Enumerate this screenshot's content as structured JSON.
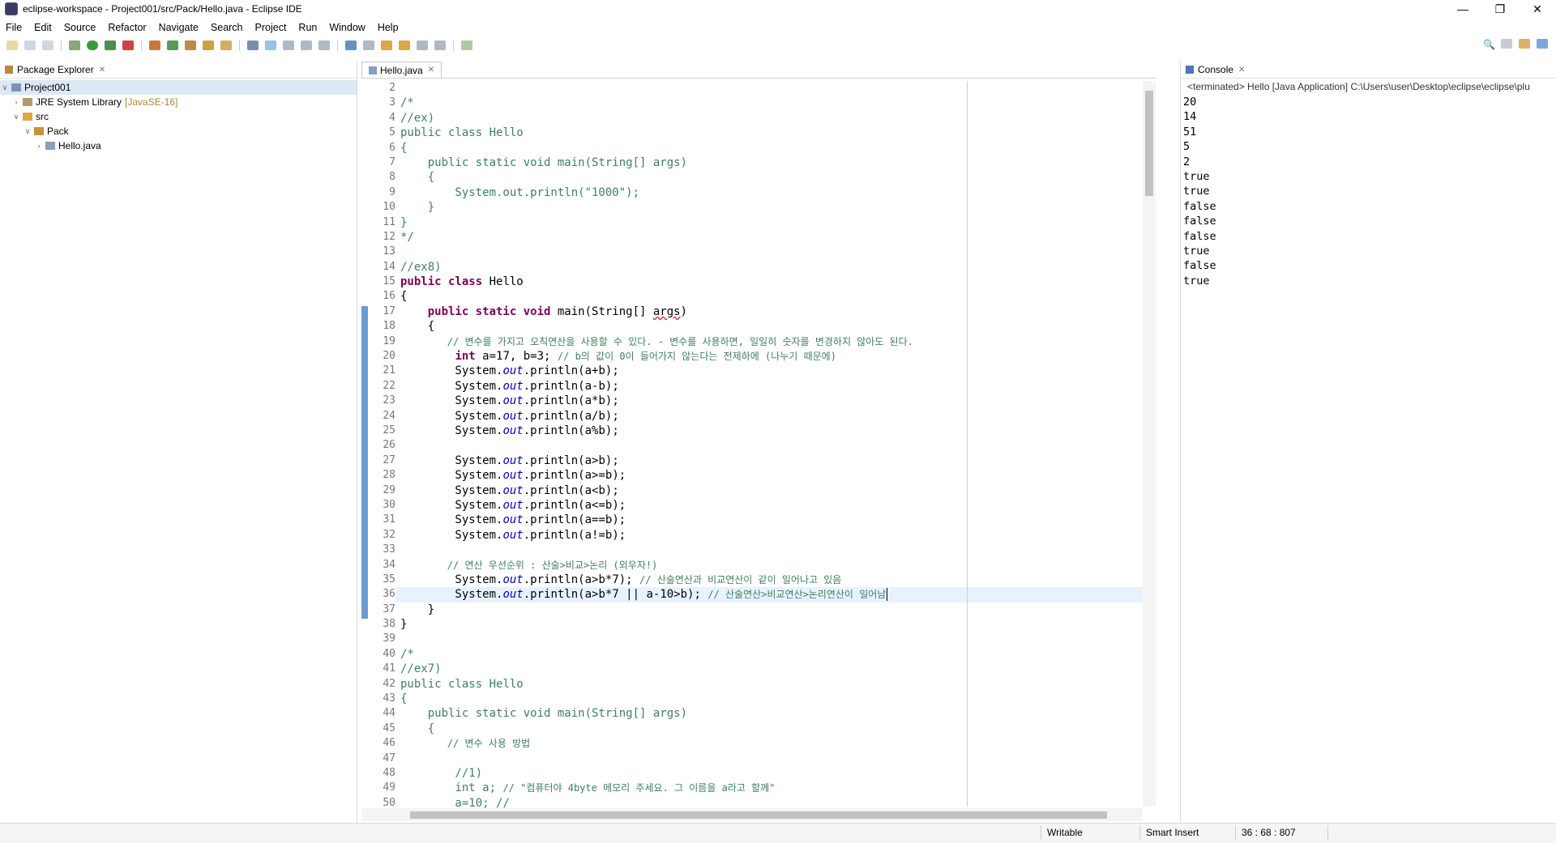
{
  "window": {
    "title": "eclipse-workspace - Project001/src/Pack/Hello.java - Eclipse IDE"
  },
  "menu": [
    "File",
    "Edit",
    "Source",
    "Refactor",
    "Navigate",
    "Search",
    "Project",
    "Run",
    "Window",
    "Help"
  ],
  "package_explorer": {
    "tab_label": "Package Explorer",
    "project": "Project001",
    "jre": "JRE System Library",
    "jre_decor": "[JavaSE-16]",
    "src": "src",
    "package": "Pack",
    "file": "Hello.java"
  },
  "editor": {
    "tab_label": "Hello.java",
    "line_numbers": [
      "2",
      "3",
      "4",
      "5",
      "6",
      "7",
      "8",
      "9",
      "10",
      "11",
      "12",
      "13",
      "14",
      "15",
      "16",
      "17",
      "18",
      "19",
      "20",
      "21",
      "22",
      "23",
      "24",
      "25",
      "26",
      "27",
      "28",
      "29",
      "30",
      "31",
      "32",
      "33",
      "34",
      "35",
      "36",
      "37",
      "38",
      "39",
      "40",
      "41",
      "42",
      "43",
      "44",
      "45",
      "46",
      "47",
      "48",
      "49",
      "50"
    ],
    "code": {
      "l3": "/*",
      "l4": "//ex)",
      "l5a": "public class",
      "l5b": " Hello",
      "l6": "{",
      "l7a": "    ",
      "l7b": "public static void",
      "l7c": " main(String[] ",
      "l7d": "args",
      "l7e": ")",
      "l8": "    {",
      "l9a": "        System.out.println(",
      "l9b": "\"1000\"",
      "l9c": ");",
      "l10": "    }",
      "l11": "}",
      "l12": "*/",
      "l14": "//ex8)",
      "l15a": "public class",
      "l15b": " Hello",
      "l16": "{",
      "l17a": "    ",
      "l17b": "public static void",
      "l17c": " main(String[] ",
      "l17d": "args",
      "l17e": ")",
      "l18": "    {",
      "l19": "        // 변수를 가지고 오칙연산을 사용할 수 있다. - 변수를 사용하면, 일일히 숫자를 변경하지 않아도 된다.",
      "l20a": "        ",
      "l20b": "int",
      "l20c": " a=17, b=3; ",
      "l20d": "// b의 값이 0이 들어가지 않는다는 전제하에 (나누기 때문에)",
      "l21": "(a+b);",
      "l22": "(a-b);",
      "l23": "(a*b);",
      "l24": "(a/b);",
      "l25": "(a%b);",
      "l27": "(a>b);",
      "l28": "(a>=b);",
      "l29": "(a<b);",
      "l30": "(a<=b);",
      "l31": "(a==b);",
      "l32": "(a!=b);",
      "l34": "        // 연산 우선순위 : 산술>비교>논리 (외우자!)",
      "l35a": "(a>b*7); ",
      "l35b": "// 산술연산과 비교연산이 같이 일어나고 있음",
      "l36a": "(a>b*7 || a-10>b); ",
      "l36b": "// 산술연산>비교연산>논리연산이 일어남",
      "l37": "    }",
      "l38": "}",
      "l40": "/*",
      "l41": "//ex7)",
      "l42a": "public class",
      "l42b": " Hello",
      "l43": "{",
      "l44a": "    ",
      "l44b": "public static void",
      "l44c": " main(String[] ",
      "l44d": "args",
      "l44e": ")",
      "l45": "    {",
      "l46": "        // 변수 사용 방법",
      "l48": "        //1)",
      "l49a": "        ",
      "l49b": "int",
      "l49c": " a; ",
      "l49d": "// \"컴퓨터야 4byte 메모리 주세요. 그 이름을 a라고 할께\"",
      "l50a": "        a=10; ",
      "l50b": "//"
    },
    "sysout_prefix": "        System.",
    "out_field": "out",
    "println": ".println"
  },
  "console": {
    "tab_label": "Console",
    "header": "<terminated> Hello [Java Application] C:\\Users\\user\\Desktop\\eclipse\\eclipse\\plu",
    "output": [
      "20",
      "14",
      "51",
      "5",
      "2",
      "true",
      "true",
      "false",
      "false",
      "false",
      "true",
      "false",
      "true"
    ]
  },
  "status": {
    "writable": "Writable",
    "insert_mode": "Smart Insert",
    "position": "36 : 68 : 807"
  }
}
